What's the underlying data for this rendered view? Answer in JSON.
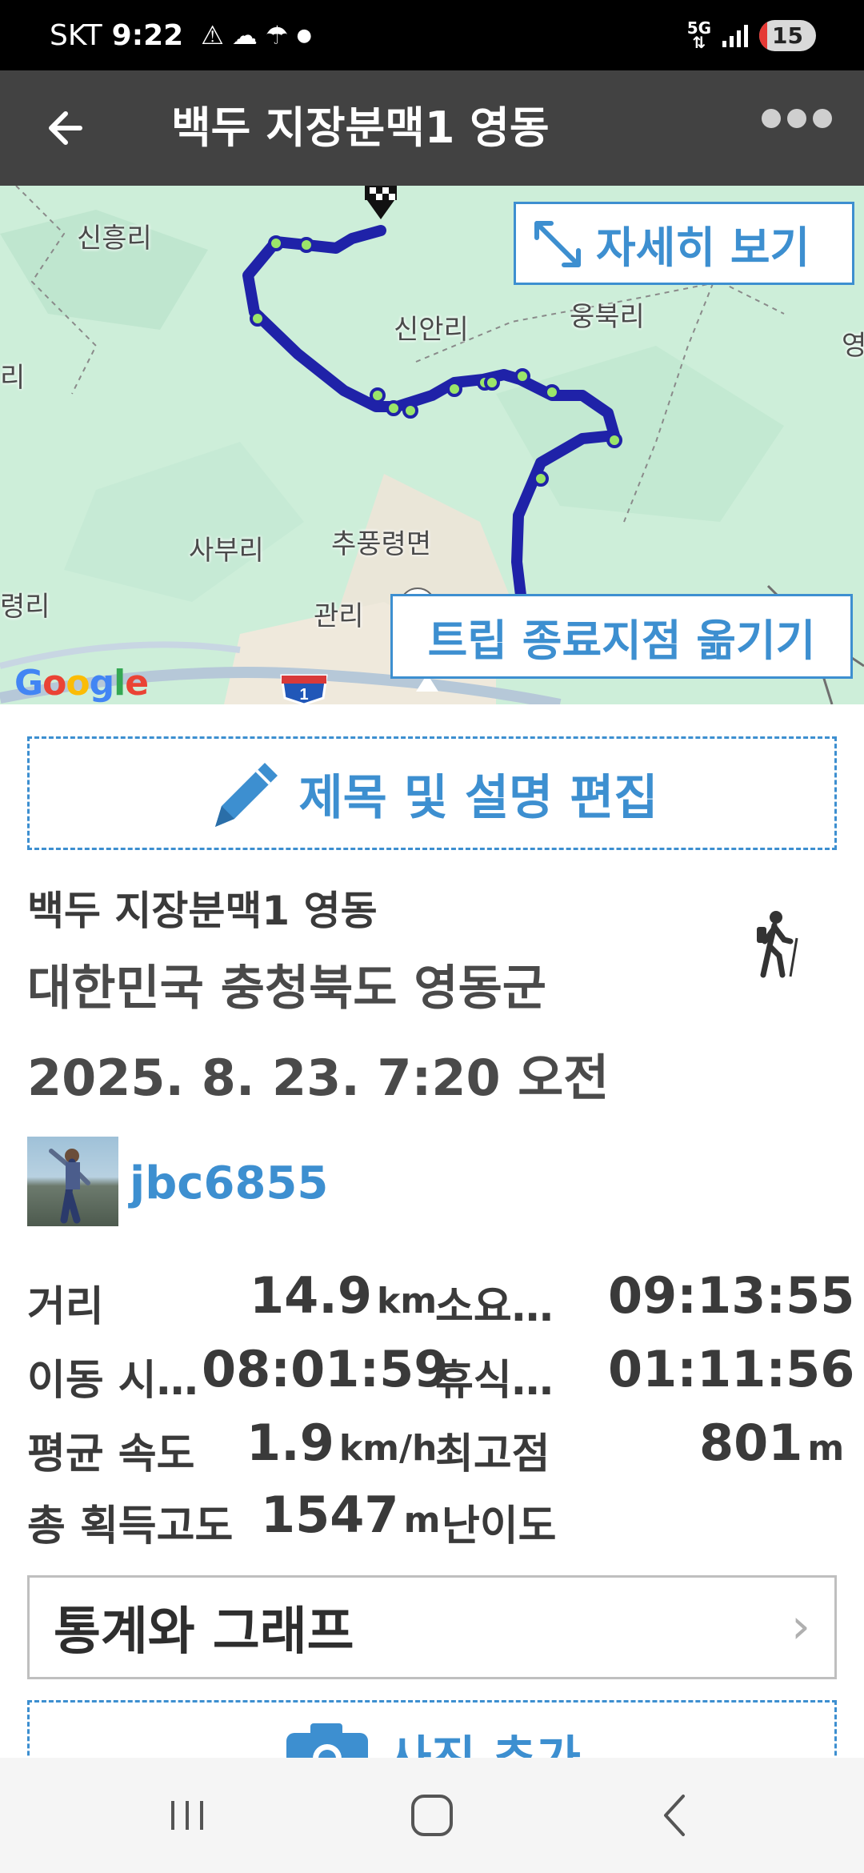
{
  "status_bar": {
    "carrier": "SKT",
    "time": "9:22",
    "network": "5G",
    "battery": "15",
    "icons": [
      "warning-icon",
      "cloud-icon",
      "weather-icon",
      "dot-icon"
    ]
  },
  "app_bar": {
    "title": "백두 지장분맥1 영동"
  },
  "map": {
    "places": [
      "신흥리",
      "신안리",
      "웅북리",
      "영",
      "리",
      "사부리",
      "추풍령면",
      "관리",
      "령리"
    ],
    "expand_label": "자세히 보기",
    "move_end_label": "트립 종료지점 옮기기",
    "google_label": "Google",
    "route_color": "#1f22a8",
    "waypoint_color": "#9be56a"
  },
  "edit_button": {
    "label": "제목 및 설명 편집"
  },
  "trip": {
    "name": "백두 지장분맥1 영동",
    "location": "대한민국 충청북도 영동군",
    "date": "2025. 8. 23. 7:20 오전",
    "activity_icon": "hiker-icon"
  },
  "user": {
    "username": "jbc6855"
  },
  "stats": {
    "distance_label": "거리",
    "distance_value": "14.9",
    "distance_unit": "km",
    "duration_label": "소요…",
    "duration_value": "09:13:55",
    "moving_label": "이동 시…",
    "moving_value": "08:01:59",
    "rest_label": "휴식…",
    "rest_value": "01:11:56",
    "avg_speed_label": "평균 속도",
    "avg_speed_value": "1.9",
    "avg_speed_unit": "km/h",
    "max_alt_label": "최고점",
    "max_alt_value": "801",
    "max_alt_unit": "m",
    "gain_label": "총 획득고도",
    "gain_value": "1547",
    "gain_unit": "m",
    "difficulty_label": "난이도"
  },
  "stats_button": {
    "label": "통계와 그래프",
    "chevron": "›"
  },
  "photo_button": {
    "label": "사진 추가"
  },
  "colors": {
    "accent": "#3d8fd0",
    "appbar": "#424242"
  }
}
